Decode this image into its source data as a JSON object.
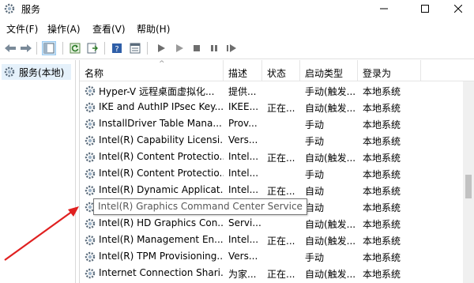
{
  "window": {
    "title": "服务",
    "icon": "gear-icon"
  },
  "menu": [
    "文件(F)",
    "操作(A)",
    "查看(V)",
    "帮助(H)"
  ],
  "tree": {
    "label": "服务(本地)"
  },
  "columns": {
    "name": "名称",
    "desc": "描述",
    "status": "状态",
    "startup": "启动类型",
    "logon": "登录为"
  },
  "rows": [
    {
      "name": "Hyper-V 远程桌面虚拟化...",
      "desc": "提供...",
      "status": "",
      "startup": "手动(触发...",
      "logon": "本地系统"
    },
    {
      "name": "IKE and AuthIP IPsec Key...",
      "desc": "IKEE...",
      "status": "正在...",
      "startup": "自动(触发...",
      "logon": "本地系统"
    },
    {
      "name": "InstallDriver Table Mana...",
      "desc": "Prov...",
      "status": "",
      "startup": "手动",
      "logon": "本地系统"
    },
    {
      "name": "Intel(R) Capability Licensi...",
      "desc": "Vers...",
      "status": "",
      "startup": "手动",
      "logon": "本地系统"
    },
    {
      "name": "Intel(R) Content Protectio...",
      "desc": "Intel...",
      "status": "正在...",
      "startup": "自动(触发...",
      "logon": "本地系统"
    },
    {
      "name": "Intel(R) Content Protectio...",
      "desc": "Intel...",
      "status": "",
      "startup": "手动",
      "logon": "本地系统"
    },
    {
      "name": "Intel(R) Dynamic Applicat...",
      "desc": "Intel...",
      "status": "正在...",
      "startup": "自动",
      "logon": "本地系统"
    },
    {
      "name": "",
      "desc": "",
      "status": "",
      "startup": "自动",
      "logon": "本地系统"
    },
    {
      "name": "Intel(R) HD Graphics Con...",
      "desc": "Servi...",
      "status": "",
      "startup": "自动(触发...",
      "logon": "本地系统"
    },
    {
      "name": "Intel(R) Management En...",
      "desc": "Intel...",
      "status": "正在...",
      "startup": "自动(触发...",
      "logon": "本地系统"
    },
    {
      "name": "Intel(R) TPM Provisioning...",
      "desc": "Vers...",
      "status": "",
      "startup": "手动",
      "logon": "本地系统"
    },
    {
      "name": "Internet Connection Shari...",
      "desc": "为家...",
      "status": "正在...",
      "startup": "自动(触发...",
      "logon": "本地系统"
    }
  ],
  "tooltip": "Intel(R) Graphics Command Center Service",
  "annotation_color": "#e02020"
}
